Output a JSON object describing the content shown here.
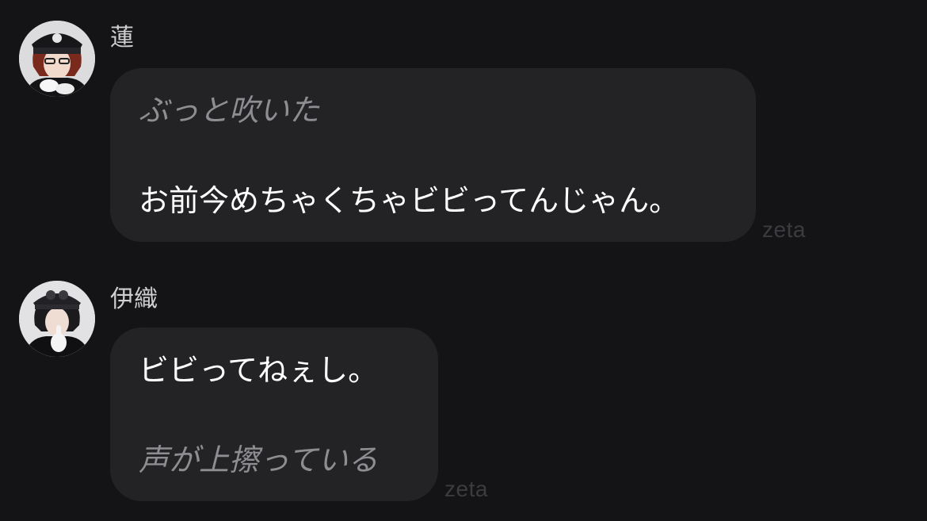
{
  "messages": [
    {
      "sender": "蓮",
      "avatar_icon": "character-avatar-red-hair-cap",
      "lines": [
        {
          "kind": "action",
          "text": "ぶっと吹いた"
        },
        {
          "kind": "speech",
          "text": "お前今めちゃくちゃビビってんじゃん。"
        }
      ],
      "watermark": "zeta"
    },
    {
      "sender": "伊織",
      "avatar_icon": "character-avatar-dark-hair-cap",
      "lines": [
        {
          "kind": "speech",
          "text": "ビビってねぇし。"
        },
        {
          "kind": "action",
          "text": "声が上擦っている"
        }
      ],
      "watermark": "zeta"
    }
  ],
  "colors": {
    "background": "#141416",
    "bubble": "#232325",
    "speech_text": "#ffffff",
    "action_text": "#8e8e92",
    "name_text": "#cfcfd2",
    "watermark": "#3c3c40"
  }
}
